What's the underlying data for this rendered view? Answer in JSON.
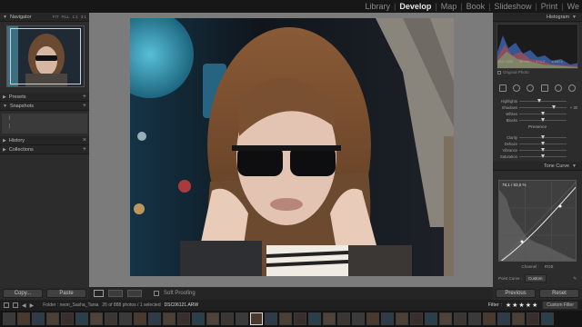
{
  "modules": [
    "Library",
    "Develop",
    "Map",
    "Book",
    "Slideshow",
    "Print",
    "We"
  ],
  "active_module": "Develop",
  "left_panel": {
    "navigator": {
      "title": "Navigator",
      "options": [
        "FIT",
        "FILL",
        "1:1",
        "3:1"
      ]
    },
    "presets": "Presets",
    "snapshots": "Snapshots",
    "history": "History",
    "collections": "Collections",
    "copy_button": "Copy...",
    "paste_button": "Paste"
  },
  "right_panel": {
    "histogram_title": "Histogram",
    "exif": [
      "ISO 2500",
      "50 mm",
      "f / 1,2",
      "1/160 s"
    ],
    "original_photo": "Original Photo",
    "basic_sliders": [
      {
        "label": "Highlights",
        "pos": 0.42,
        "value": ""
      },
      {
        "label": "Shadows",
        "pos": 0.74,
        "value": "+ 30"
      },
      {
        "label": "Whites",
        "pos": 0.5,
        "value": ""
      },
      {
        "label": "Blacks",
        "pos": 0.5,
        "value": ""
      }
    ],
    "presence_title": "Presence",
    "presence_sliders": [
      {
        "label": "Clarity",
        "pos": 0.5,
        "value": ""
      },
      {
        "label": "Dehaze",
        "pos": 0.5,
        "value": ""
      },
      {
        "label": "Vibrance",
        "pos": 0.5,
        "value": ""
      },
      {
        "label": "Saturation",
        "pos": 0.5,
        "value": ""
      }
    ],
    "tone_curve_title": "Tone Curve",
    "curve_readout": "78,1 / 83,5 %",
    "channel_label": "Channel :",
    "channel_value": "RGB",
    "point_curve_label": "Point Curve :",
    "point_curve_value": "Custom",
    "previous_button": "Previous",
    "reset_button": "Reset"
  },
  "toolbar": {
    "soft_proofing": "Soft Proofing"
  },
  "filmstrip": {
    "folder": "Folder : neon_Sasha_Tania",
    "count": "26 of 888 photos / 1 selected",
    "filename": "DSC06121.ARW",
    "filter_label": "Filter :",
    "stars": "★★★★★",
    "custom_filter": "Custom Filter"
  },
  "colors": {
    "accent": "#e6e6e6",
    "panel": "#2c2c2c",
    "canvas": "#7b7b7b"
  }
}
